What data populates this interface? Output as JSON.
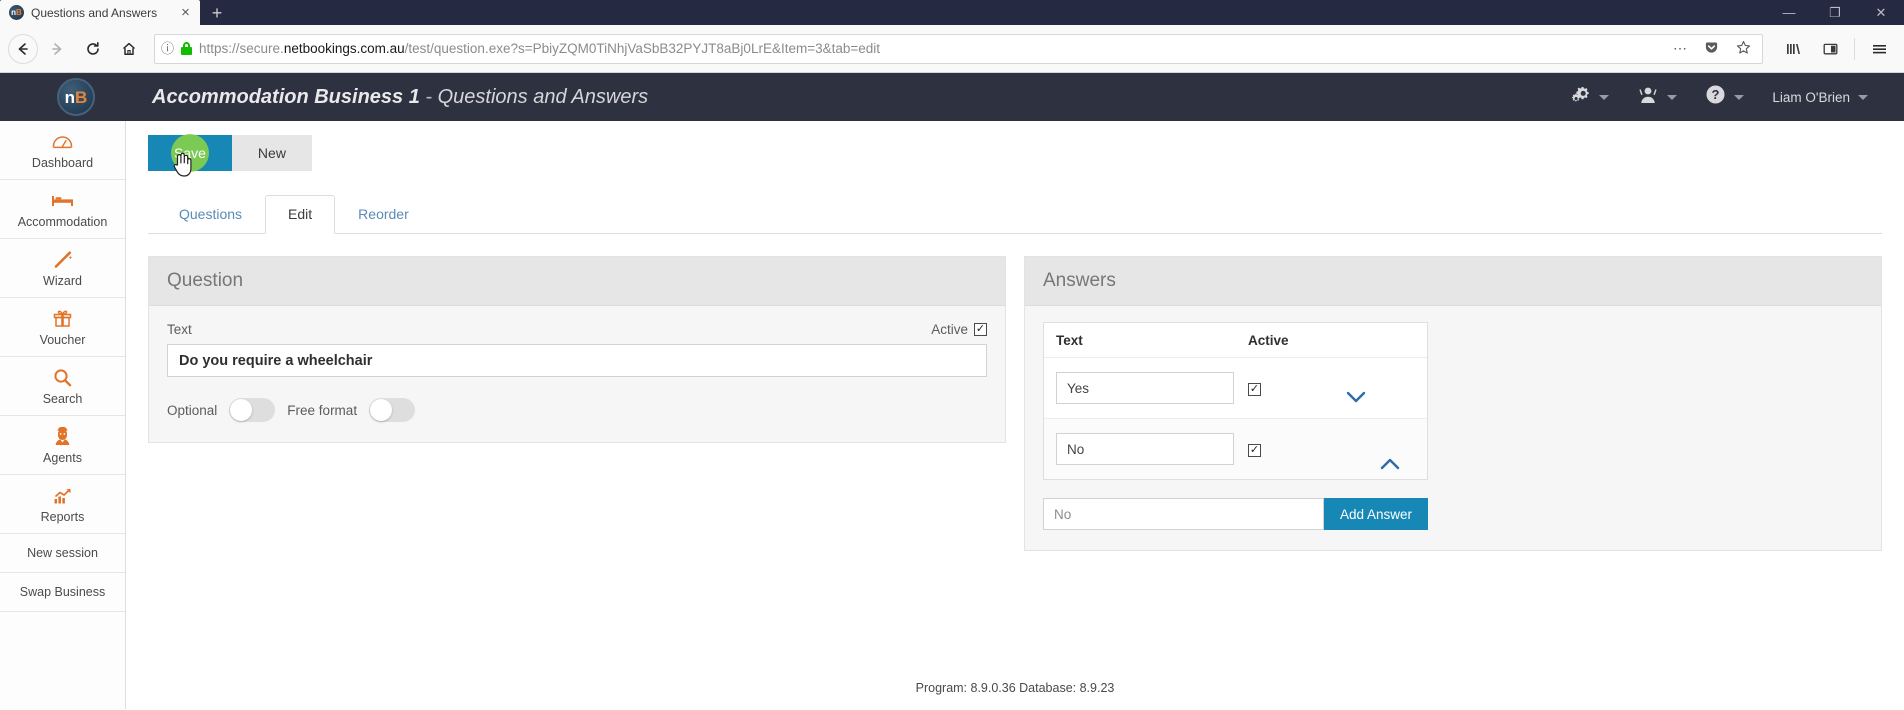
{
  "browser": {
    "tab_title": "Questions and Answers",
    "favicon_text_n": "n",
    "favicon_text_b": "B",
    "new_tab_label": "+",
    "close_tab_label": "×",
    "window_minimize": "—",
    "window_maximize": "❐",
    "window_close": "✕",
    "url_prefix": "https://secure.",
    "url_domain": "netbookings.com.au",
    "url_path": "/test/question.exe?s=PbiyZQM0TiNhjVaSbB32PYJT8aBj0LrE&Item=3&tab=edit",
    "url_full": "https://secure.netbookings.com.au/test/question.exe?s=PbiyZQM0TiNhjVaSbB32PYJT8aBj0LrE&Item=3&tab=edit",
    "back_icon": "←",
    "forward_icon": "→",
    "reload_icon": "↻",
    "home_icon": "⌂",
    "info_icon": "ⓘ",
    "page_actions_icon": "⋯",
    "pocket_icon": "pocket",
    "bookmark_icon": "☆",
    "library_icon": "library",
    "sidebar_icon": "sidebar",
    "menu_icon": "☰"
  },
  "header": {
    "logo_n": "n",
    "logo_b": "B",
    "business": "Accommodation Business 1",
    "separator": " - ",
    "page": "Questions and Answers",
    "settings_icon": "cogs-icon",
    "user_icon": "user-icon",
    "help_icon": "?",
    "username": "Liam O'Brien"
  },
  "sidebar": {
    "items": [
      {
        "label": "Dashboard",
        "icon": "◔"
      },
      {
        "label": "Accommodation",
        "icon": "Ὤf"
      },
      {
        "label": "Wizard",
        "icon": "✦"
      },
      {
        "label": "Voucher",
        "icon": "Ἰ1"
      },
      {
        "label": "Search",
        "icon": "ὐd"
      },
      {
        "label": "Agents",
        "icon": "὆4"
      },
      {
        "label": "Reports",
        "icon": "Ὄ8"
      }
    ],
    "plain_items": [
      {
        "label": "New session"
      },
      {
        "label": "Swap Business"
      }
    ]
  },
  "toolbar": {
    "save_label": "Save",
    "new_label": "New"
  },
  "tabs": [
    {
      "label": "Questions",
      "active": false
    },
    {
      "label": "Edit",
      "active": true
    },
    {
      "label": "Reorder",
      "active": false
    }
  ],
  "question_panel": {
    "title": "Question",
    "text_label": "Text",
    "active_label": "Active",
    "active_checked": true,
    "check_glyph": "✓",
    "question_value": "Do you require a wheelchair",
    "optional_label": "Optional",
    "optional_on": false,
    "free_format_label": "Free format",
    "free_format_on": false
  },
  "answers_panel": {
    "title": "Answers",
    "columns": {
      "text": "Text",
      "active": "Active"
    },
    "check_glyph": "✓",
    "rows": [
      {
        "text": "Yes",
        "active": true,
        "move_icon": "chevron-down",
        "move_glyph": "⌄"
      },
      {
        "text": "No",
        "active": true,
        "move_icon": "chevron-up",
        "move_glyph": "⌃"
      }
    ],
    "add_value": "No",
    "add_placeholder": "No",
    "add_button_label": "Add Answer"
  },
  "footer": {
    "text": "Program: 8.9.0.36 Database: 8.9.23"
  },
  "colors": {
    "accent_blue": "#1787b5",
    "brand_orange": "#e2742a",
    "header_dark": "#2e313f",
    "click_green": "#8ad447",
    "link_blue": "#5a8bb5"
  }
}
